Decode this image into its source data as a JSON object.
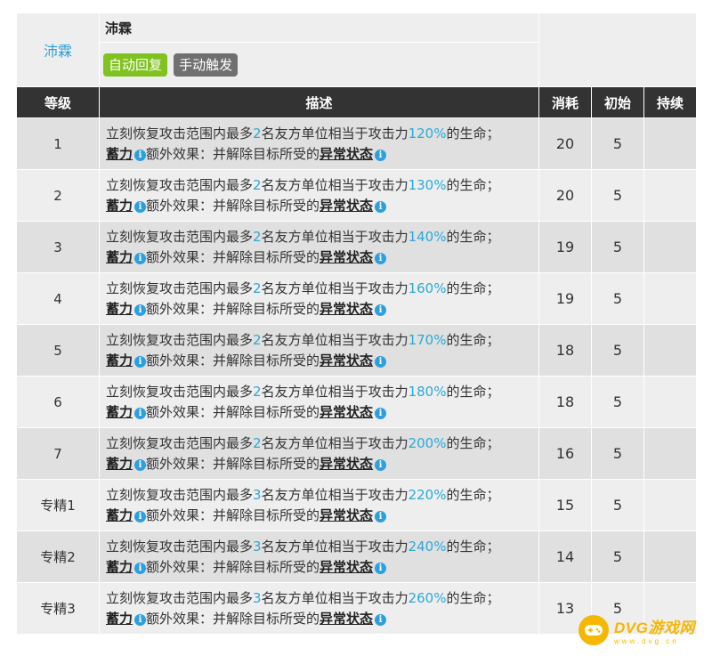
{
  "skill": {
    "link_name": "沛霖",
    "title": "沛霖",
    "tags": [
      {
        "label": "自动回复",
        "color": "#80c21f"
      },
      {
        "label": "手动触发",
        "color": "#707070"
      }
    ]
  },
  "headers": {
    "level": "等级",
    "desc": "描述",
    "cost": "消耗",
    "initial": "初始",
    "duration": "持续"
  },
  "desc_parts": {
    "prefix": "立刻恢复攻击范围内最多",
    "mid": "名友方单位相当于攻击力",
    "suffix": "的生命；",
    "charge": "蓄力",
    "extra": "额外效果：并解除目标所受的",
    "status": "异常状态"
  },
  "rows": [
    {
      "level": "1",
      "targets": "2",
      "percent": "120%",
      "cost": "20",
      "initial": "5",
      "duration": ""
    },
    {
      "level": "2",
      "targets": "2",
      "percent": "130%",
      "cost": "20",
      "initial": "5",
      "duration": ""
    },
    {
      "level": "3",
      "targets": "2",
      "percent": "140%",
      "cost": "19",
      "initial": "5",
      "duration": ""
    },
    {
      "level": "4",
      "targets": "2",
      "percent": "160%",
      "cost": "19",
      "initial": "5",
      "duration": ""
    },
    {
      "level": "5",
      "targets": "2",
      "percent": "170%",
      "cost": "18",
      "initial": "5",
      "duration": ""
    },
    {
      "level": "6",
      "targets": "2",
      "percent": "180%",
      "cost": "18",
      "initial": "5",
      "duration": ""
    },
    {
      "level": "7",
      "targets": "2",
      "percent": "200%",
      "cost": "16",
      "initial": "5",
      "duration": ""
    },
    {
      "level": "专精1",
      "targets": "3",
      "percent": "220%",
      "cost": "15",
      "initial": "5",
      "duration": ""
    },
    {
      "level": "专精2",
      "targets": "3",
      "percent": "240%",
      "cost": "14",
      "initial": "5",
      "duration": ""
    },
    {
      "level": "专精3",
      "targets": "3",
      "percent": "260%",
      "cost": "13",
      "initial": "5",
      "duration": ""
    }
  ],
  "info_glyph": "i",
  "watermark": {
    "main": "DVG游戏网",
    "sub": "www.dvg.cn",
    "color": "#f5b700"
  },
  "colors": {
    "header_bg": "#333333",
    "highlight": "#2ba9d6",
    "link": "#2c9fd6"
  }
}
